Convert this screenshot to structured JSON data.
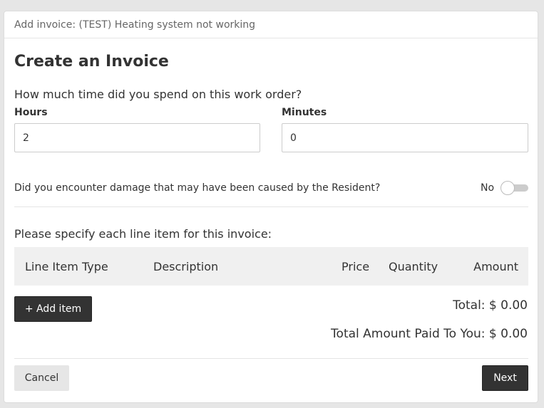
{
  "header": {
    "title": "Add invoice: (TEST) Heating system not working"
  },
  "form": {
    "title": "Create an Invoice",
    "time_question": "How much time did you spend on this work order?",
    "hours": {
      "label": "Hours",
      "value": "2"
    },
    "minutes": {
      "label": "Minutes",
      "value": "0"
    },
    "damage_question": "Did you encounter damage that may have been caused by the Resident?",
    "damage_toggle": {
      "label": "No",
      "on": false
    },
    "line_items_prompt": "Please specify each line item for this invoice:"
  },
  "table": {
    "columns": {
      "type": "Line Item Type",
      "description": "Description",
      "price": "Price",
      "quantity": "Quantity",
      "amount": "Amount"
    }
  },
  "actions": {
    "add_item": "+ Add item",
    "cancel": "Cancel",
    "next": "Next"
  },
  "totals": {
    "total": "Total: $ 0.00",
    "paid_to_you": "Total Amount Paid To You: $ 0.00"
  },
  "colors": {
    "dark_button": "#333333",
    "light_button": "#e6e6e6",
    "table_header_bg": "#f0f0f0",
    "page_bg": "#e6e6e6"
  }
}
